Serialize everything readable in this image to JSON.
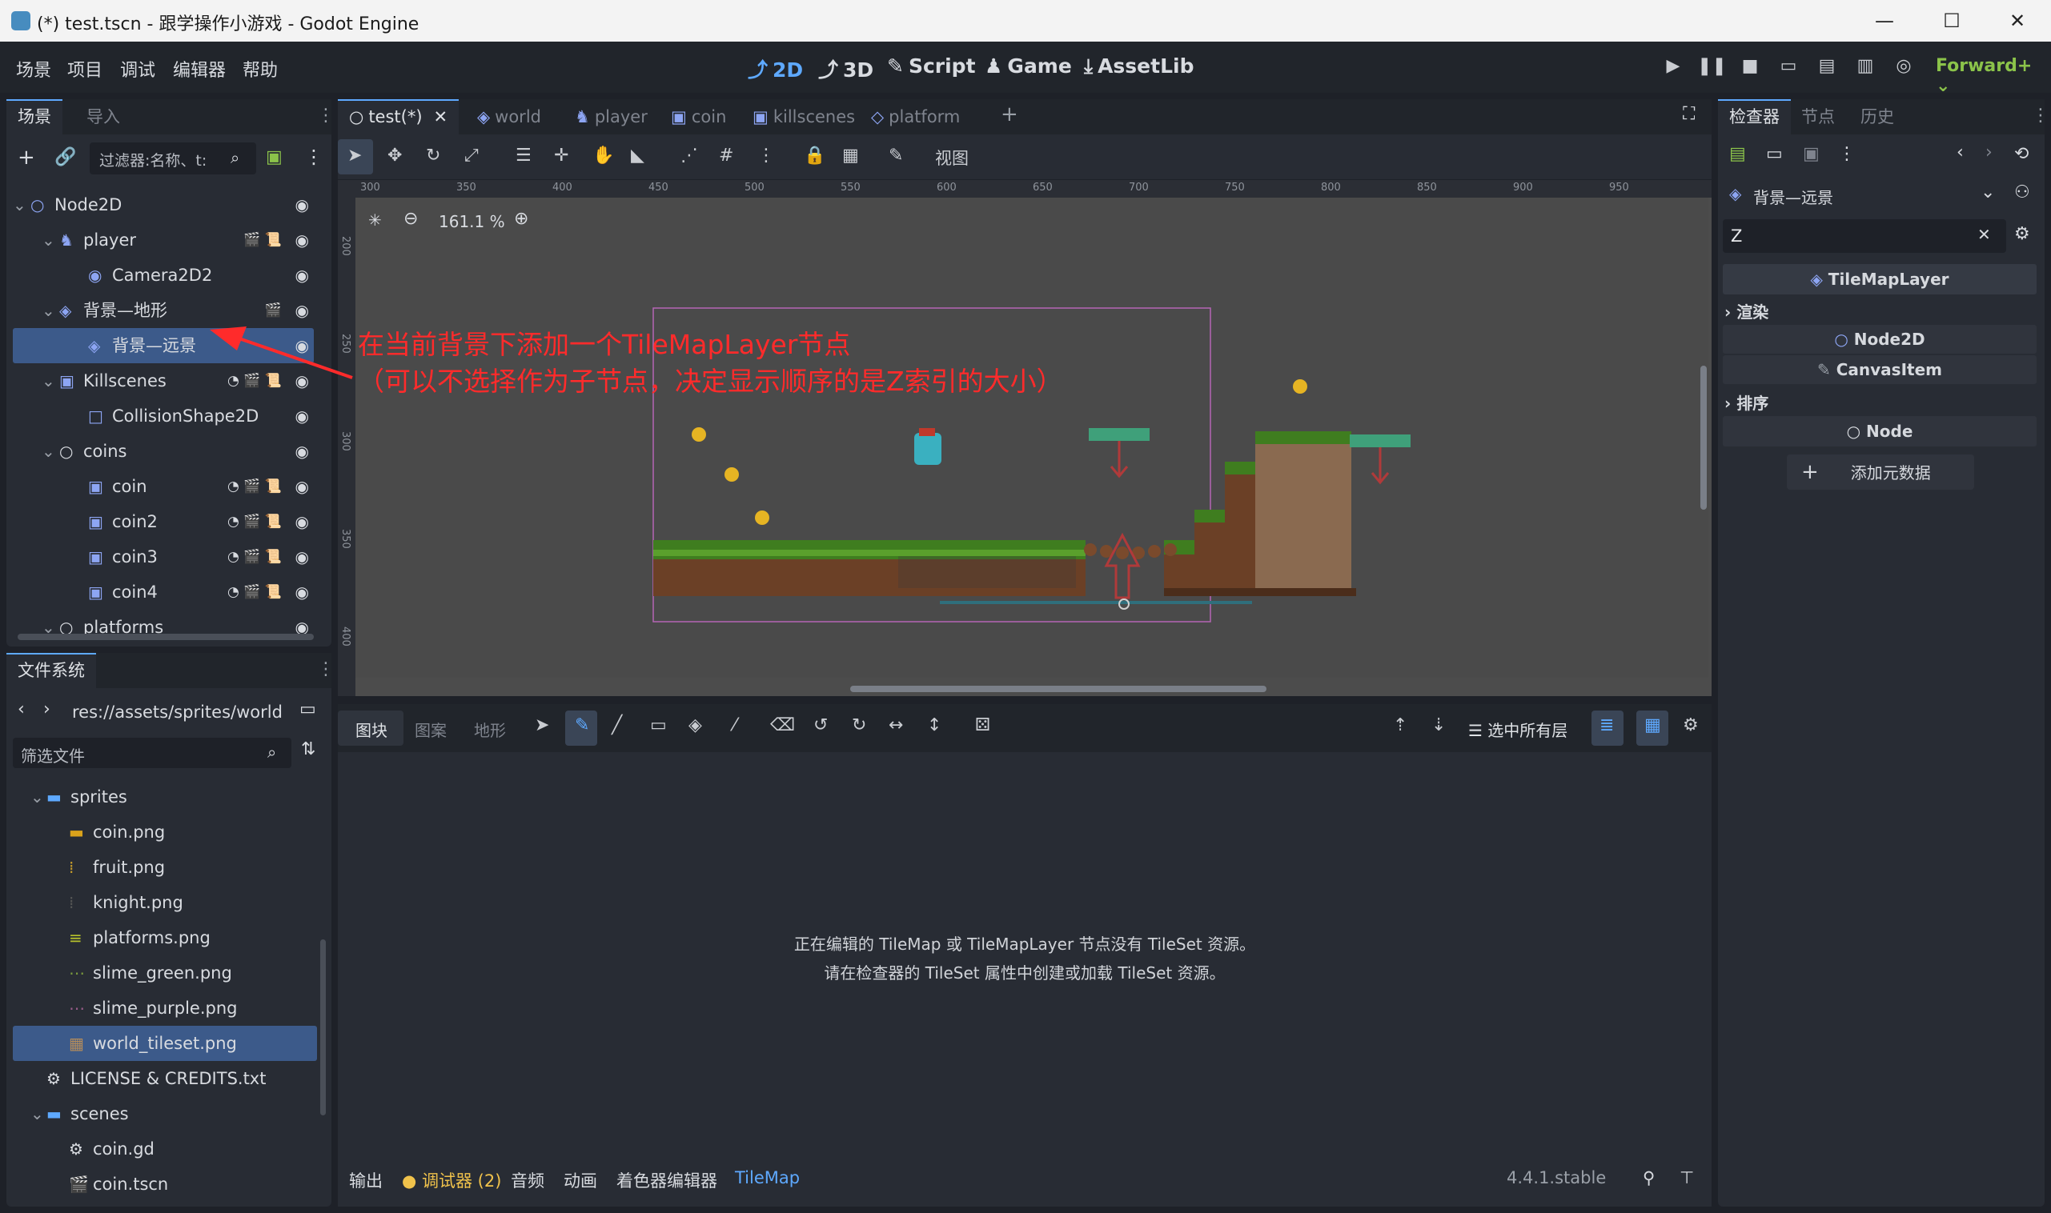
{
  "window": {
    "title": "(*) test.tscn - 跟学操作小游戏 - Godot Engine",
    "min": "—",
    "max": "☐",
    "close": "✕"
  },
  "menu": [
    "场景",
    "项目",
    "调试",
    "编辑器",
    "帮助"
  ],
  "workspaces": [
    {
      "label": "2D",
      "icon": "⤴",
      "active": true
    },
    {
      "label": "3D",
      "icon": "⤴",
      "active": false
    },
    {
      "label": "Script",
      "icon": "✎",
      "active": false
    },
    {
      "label": "Game",
      "icon": "♟",
      "active": false
    },
    {
      "label": "AssetLib",
      "icon": "⤓",
      "active": false
    }
  ],
  "renderer": "Forward+",
  "scene_dock": {
    "tabs": [
      "场景",
      "导入"
    ],
    "filter_placeholder": "过滤器:名称、t:",
    "nodes": [
      {
        "label": "Node2D",
        "icon": "○",
        "level": 0,
        "color": "#8da5f3",
        "arrow": "⌄"
      },
      {
        "label": "player",
        "icon": "♞",
        "level": 1,
        "color": "#8da5f3",
        "arrow": "⌄",
        "extras": "🎬 📜"
      },
      {
        "label": "Camera2D2",
        "icon": "◉",
        "level": 2,
        "color": "#8da5f3",
        "arrow": ""
      },
      {
        "label": "背景—地形",
        "icon": "◈",
        "level": 1,
        "color": "#8da5f3",
        "arrow": "⌄",
        "extras": "🎬"
      },
      {
        "label": "背景—远景",
        "icon": "◈",
        "level": 2,
        "color": "#8da5f3",
        "arrow": "",
        "selected": true
      },
      {
        "label": "Killscenes",
        "icon": "▣",
        "level": 1,
        "color": "#8da5f3",
        "arrow": "⌄",
        "extras": "◔ 🎬 📜"
      },
      {
        "label": "CollisionShape2D",
        "icon": "□",
        "level": 2,
        "color": "#8da5f3",
        "arrow": ""
      },
      {
        "label": "coins",
        "icon": "○",
        "level": 1,
        "color": "#d8dbe0",
        "arrow": "⌄"
      },
      {
        "label": "coin",
        "icon": "▣",
        "level": 2,
        "color": "#8da5f3",
        "arrow": "",
        "extras": "◔ 🎬 📜"
      },
      {
        "label": "coin2",
        "icon": "▣",
        "level": 2,
        "color": "#8da5f3",
        "arrow": "",
        "extras": "◔ 🎬 📜"
      },
      {
        "label": "coin3",
        "icon": "▣",
        "level": 2,
        "color": "#8da5f3",
        "arrow": "",
        "extras": "◔ 🎬 📜"
      },
      {
        "label": "coin4",
        "icon": "▣",
        "level": 2,
        "color": "#8da5f3",
        "arrow": "",
        "extras": "◔ 🎬 📜"
      },
      {
        "label": "platforms",
        "icon": "○",
        "level": 1,
        "color": "#d8dbe0",
        "arrow": "⌄"
      }
    ]
  },
  "filesystem": {
    "tab": "文件系统",
    "path": "res://assets/sprites/world",
    "filter_placeholder": "筛选文件",
    "items": [
      {
        "label": "sprites",
        "icon": "▬",
        "level": 1,
        "arrow": "⌄",
        "color": "#5ea9ff"
      },
      {
        "label": "coin.png",
        "icon": "▬",
        "level": 2,
        "color": "#d9a21b"
      },
      {
        "label": "fruit.png",
        "icon": "⁞",
        "level": 2,
        "color": "#c59b2b"
      },
      {
        "label": "knight.png",
        "icon": "⁞",
        "level": 2,
        "color": "#555"
      },
      {
        "label": "platforms.png",
        "icon": "≡",
        "level": 2,
        "color": "#b7c22c"
      },
      {
        "label": "slime_green.png",
        "icon": "⋯",
        "level": 2,
        "color": "#7a9a3d"
      },
      {
        "label": "slime_purple.png",
        "icon": "⋯",
        "level": 2,
        "color": "#9a5d8b"
      },
      {
        "label": "world_tileset.png",
        "icon": "▦",
        "level": 2,
        "color": "#b68d5b",
        "selected": true
      },
      {
        "label": "LICENSE & CREDITS.txt",
        "icon": "⚙",
        "level": 1,
        "color": "#d8dbe0"
      },
      {
        "label": "scenes",
        "icon": "▬",
        "level": 1,
        "arrow": "⌄",
        "color": "#5ea9ff"
      },
      {
        "label": "coin.gd",
        "icon": "⚙",
        "level": 2,
        "color": "#d8dbe0"
      },
      {
        "label": "coin.tscn",
        "icon": "🎬",
        "level": 2,
        "color": "#d8dbe0"
      }
    ]
  },
  "editor_tabs": [
    {
      "label": "test(*)",
      "icon": "○",
      "active": true
    },
    {
      "label": "world",
      "icon": "◈"
    },
    {
      "label": "player",
      "icon": "♞"
    },
    {
      "label": "coin",
      "icon": "▣"
    },
    {
      "label": "killscenes",
      "icon": "▣"
    },
    {
      "label": "platform",
      "icon": "◇"
    }
  ],
  "viewport": {
    "zoom": "161.1 %",
    "toolbar_view_label": "视图",
    "ruler_h": [
      "300",
      "350",
      "400",
      "450",
      "500",
      "550",
      "600",
      "650",
      "700",
      "750",
      "800",
      "850",
      "900",
      "950"
    ],
    "ruler_v": [
      "200",
      "250",
      "300",
      "350",
      "400"
    ]
  },
  "annotation": {
    "line1": "在当前背景下添加一个TileMapLayer节点",
    "line2": "（可以不选择作为子节点，决定显示顺序的是Z索引的大小）",
    "color": "#ff2b2b"
  },
  "tilemap_panel": {
    "tabs": [
      "图块",
      "图案",
      "地形"
    ],
    "layer_label": "选中所有层",
    "message1": "正在编辑的 TileMap 或 TileMapLayer 节点没有 TileSet 资源。",
    "message2": "请在检查器的 TileSet 属性中创建或加载 TileSet 资源。"
  },
  "bottom_tabs": [
    "输出",
    "调试器 (2)",
    "音频",
    "动画",
    "着色器编辑器",
    "TileMap"
  ],
  "version": "4.4.1.stable",
  "inspector": {
    "tabs": [
      "检查器",
      "节点",
      "历史"
    ],
    "node_name": "背景—远景",
    "search_value": "Z",
    "class": "TileMapLayer",
    "section1": "渲染",
    "sub1": "Node2D",
    "sub2": "CanvasItem",
    "section2": "排序",
    "sub3": "Node",
    "add_meta": "添加元数据"
  }
}
